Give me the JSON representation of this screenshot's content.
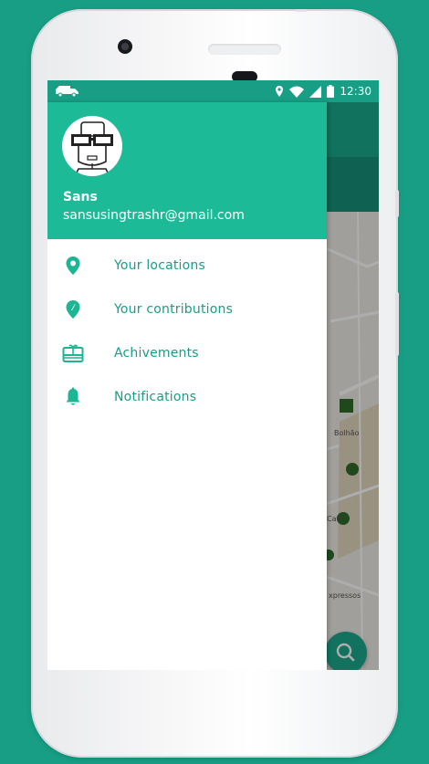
{
  "status_bar": {
    "time": "12:30"
  },
  "drawer": {
    "user": {
      "name": "Sans",
      "email": "sansusingtrashr@gmail.com"
    },
    "menu": [
      {
        "label": "Your locations",
        "icon": "location-pin-icon"
      },
      {
        "label": "Your contributions",
        "icon": "contribution-pin-icon"
      },
      {
        "label": "Achivements",
        "icon": "gift-card-icon"
      },
      {
        "label": "Notifications",
        "icon": "bell-icon"
      }
    ]
  },
  "map": {
    "labels": [
      "Bolhão",
      "Café",
      "xpressos"
    ],
    "search_button_icon": "search-icon"
  },
  "colors": {
    "background": "#179e84",
    "header": "#1dba98",
    "accent_text": "#179e84",
    "status_bar": "#179e84"
  }
}
